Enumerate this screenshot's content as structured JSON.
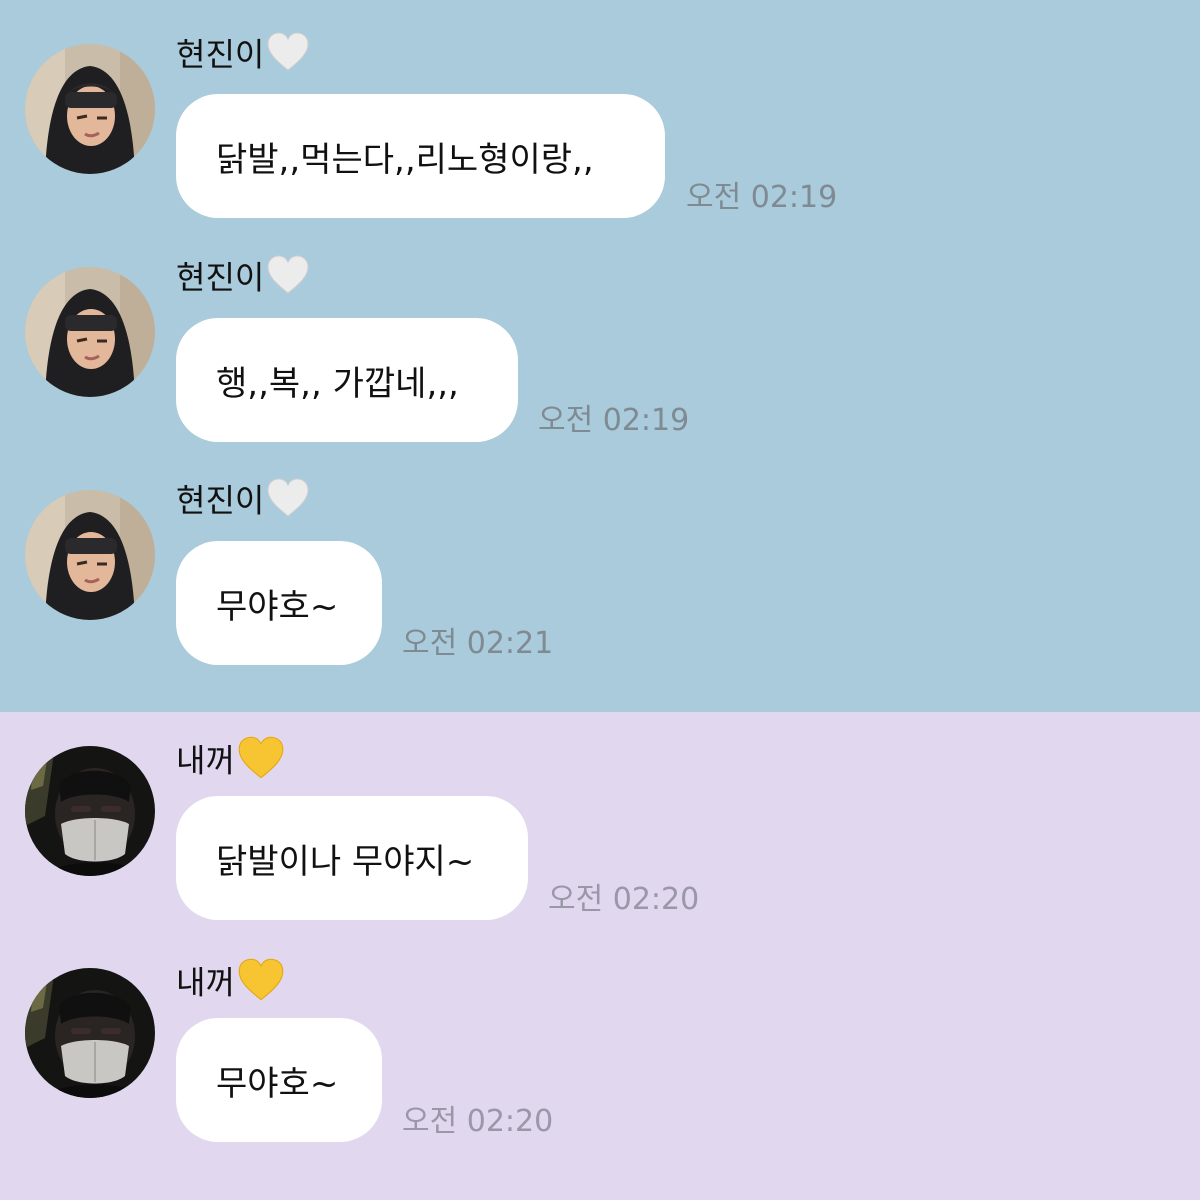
{
  "colors": {
    "top_background": "#a9cbdb",
    "bottom_background": "#e1d7ef",
    "bubble": "#ffffff",
    "white_heart": "#ececec",
    "yellow_heart": "#f7c531"
  },
  "top_messages": [
    {
      "sender": "현진이",
      "heart": "white-heart-icon",
      "text": "닭발,,먹는다,,리노형이랑,,",
      "time": "오전 02:19"
    },
    {
      "sender": "현진이",
      "heart": "white-heart-icon",
      "text": "행,,복,, 가깝네,,,",
      "time": "오전 02:19"
    },
    {
      "sender": "현진이",
      "heart": "white-heart-icon",
      "text": "무야호~",
      "time": "오전 02:21"
    }
  ],
  "bottom_messages": [
    {
      "sender": "내꺼",
      "heart": "yellow-heart-icon",
      "text": "닭발이나 무야지~",
      "time": "오전 02:20"
    },
    {
      "sender": "내꺼",
      "heart": "yellow-heart-icon",
      "text": "무야호~",
      "time": "오전 02:20"
    }
  ]
}
